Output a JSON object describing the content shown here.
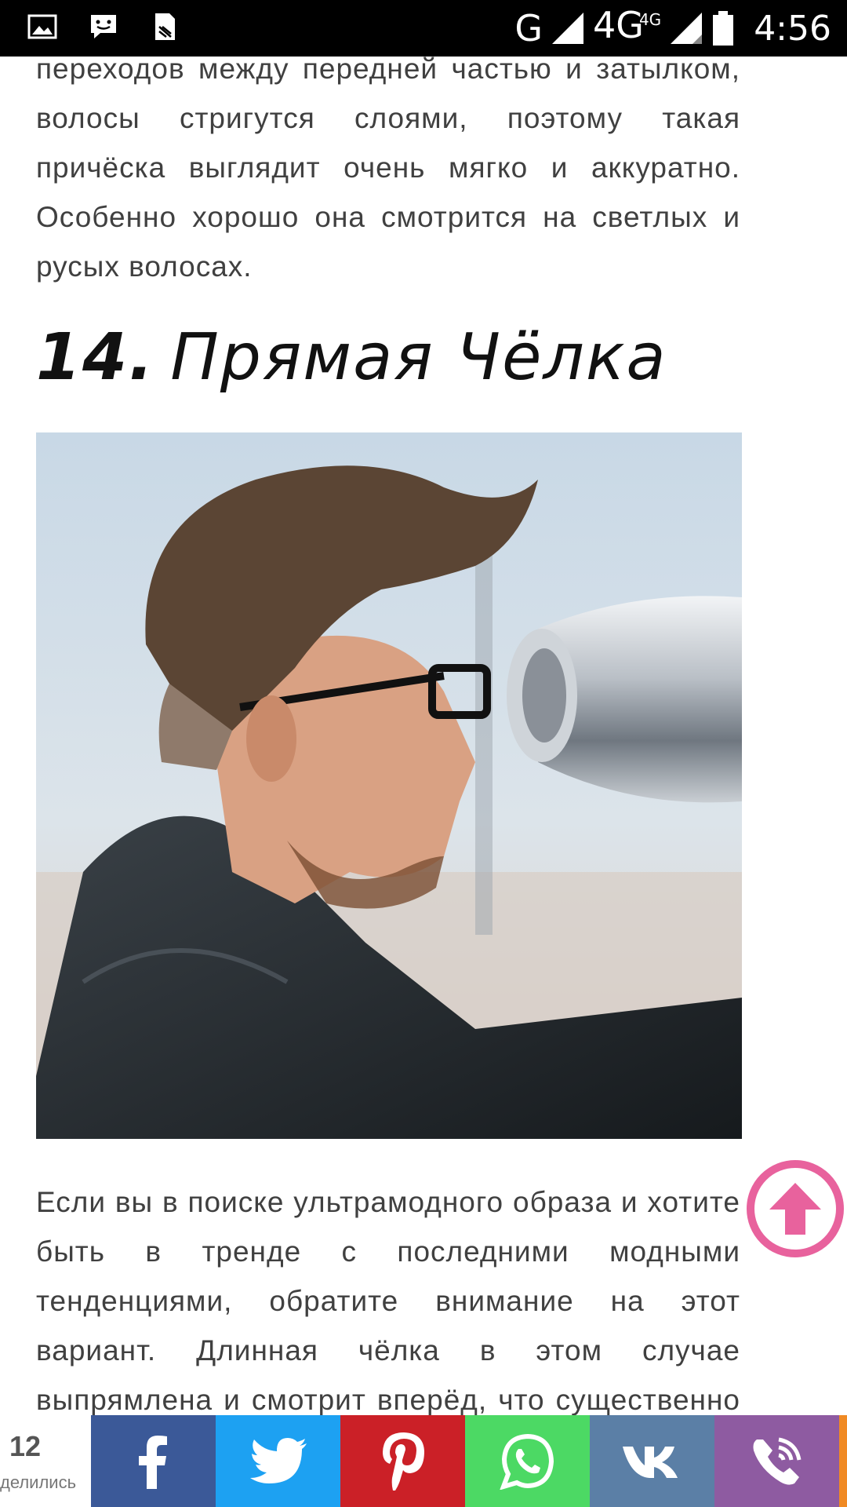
{
  "status_bar": {
    "network_g": "G",
    "network_4g": "4G",
    "network_4g_sup": "4G",
    "time": "4:56"
  },
  "article": {
    "paragraph_top": "переходов между передней частью и затылком, волосы стригутся слоями, поэтому такая причёска выглядит очень мягко и аккуратно. Особенно хорошо она смотрится на светлых и русых волосах.",
    "section": {
      "number": "14.",
      "title": "Прямая Чёлка"
    },
    "paragraph_bottom": "Если вы в поиске ультрамодного образа и хотите быть в тренде с последними модными тенденциями, обратите внимание на этот вариант. Длинная чёлка в этом случае выпрямлена и смотрит вперёд, что существенно освежает образ и придаёт ему"
  },
  "share": {
    "count": "12",
    "count_label": "делились",
    "buttons": [
      {
        "icon": "facebook-icon",
        "color": "#3b5998"
      },
      {
        "icon": "twitter-icon",
        "color": "#1da1f2"
      },
      {
        "icon": "pinterest-icon",
        "color": "#cb2027"
      },
      {
        "icon": "whatsapp-icon",
        "color": "#4cd964"
      },
      {
        "icon": "vk-icon",
        "color": "#5b7fa6"
      },
      {
        "icon": "viber-icon",
        "color": "#8e5ba1"
      }
    ]
  },
  "colors": {
    "accent_pink": "#e8629d",
    "text": "#404040",
    "edge_orange": "#f08a24"
  }
}
